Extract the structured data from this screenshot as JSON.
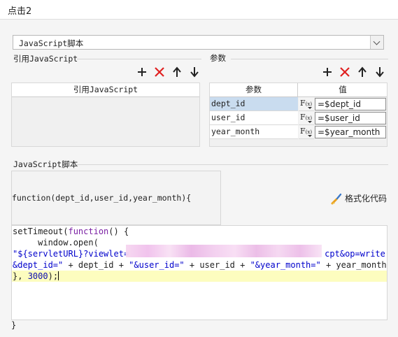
{
  "window": {
    "title": "点击2"
  },
  "script_type_select": {
    "value": "JavaScript脚本"
  },
  "ref_section": {
    "label": "引用JavaScript",
    "column_header": "引用JavaScript"
  },
  "param_section": {
    "label": "参数",
    "headers": [
      "参数",
      "值"
    ],
    "rows": [
      {
        "name": "dept_id",
        "fx": "F(x)",
        "value": "=$dept_id",
        "selected": true
      },
      {
        "name": "user_id",
        "fx": "F(x)",
        "value": "=$user_id",
        "selected": false
      },
      {
        "name": "year_month",
        "fx": "F(x)",
        "value": "=$year_month",
        "selected": false
      }
    ]
  },
  "script_section": {
    "label": "JavaScript脚本",
    "signature": "function(dept_id,user_id,year_month){",
    "format_button": "格式化代码",
    "closing_brace": "}"
  },
  "code": {
    "line1_a": "setTimeout(",
    "line1_kw": "function",
    "line1_b": "() {",
    "line2": "     window.open(",
    "line3_str_start": "\"${servletURL}?viewlet=",
    "line3_str_end": "cpt&op=write",
    "line4_a": "&dept_id=\"",
    "line4_b": " + dept_id + ",
    "line4_c": "\"&user_id=\"",
    "line4_d": " + user_id + ",
    "line4_e": "\"&year_month=\"",
    "line4_f": " + year_month);",
    "line5_a": "}, ",
    "line5_num": "3000",
    "line5_b": ");"
  },
  "icons": {
    "add": "plus-icon",
    "delete": "red-x-icon",
    "up": "arrow-up-icon",
    "down": "arrow-down-icon",
    "format": "brush-icon"
  },
  "colors": {
    "delete_red": "#e02020",
    "selection": "#c9dcef",
    "highlight_line": "#fdfdbf"
  }
}
